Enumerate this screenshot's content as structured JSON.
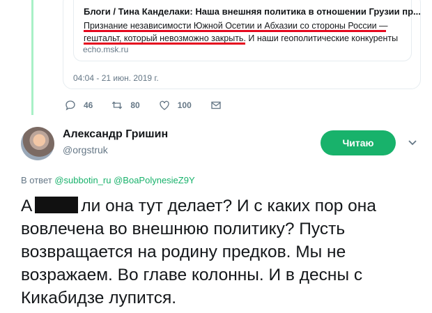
{
  "quoted": {
    "card_title": "Блоги / Тина Канделаки: Наша внешняя политика в отношении Грузии пр...",
    "card_desc_part1": "Признание независимости Южной Осетии и Абхазии со стороны России —",
    "card_desc_part2": "гештальт, который невозможно закрыть",
    "card_desc_part3": ". И наши геополитические конкуренты",
    "card_domain": "echo.msk.ru",
    "timestamp": "04:04 - 21 июн. 2019 г.",
    "replies": "46",
    "retweets": "80",
    "likes": "100"
  },
  "tweet": {
    "name": "Александр Гришин",
    "handle": "@orgstruk",
    "follow_label": "Читаю",
    "reply_prefix": "В ответ",
    "reply_user1": "@subbotin_ru",
    "reply_user2": "@BoaPolynesieZ9Y",
    "text_start": "А",
    "text_rest": "ли она тут делает? И с каких пор она вовлечена во внешнюю политику? Пусть возвращается на родину предков. Мы не возражаем. Во главе колонны. И в десны с Кикабидзе лупится."
  },
  "colors": {
    "accent": "#18b26b",
    "underline": "#e5091e",
    "muted": "#657786"
  },
  "icons": [
    "reply-icon",
    "retweet-icon",
    "like-icon",
    "message-icon",
    "chevron-down-icon"
  ]
}
